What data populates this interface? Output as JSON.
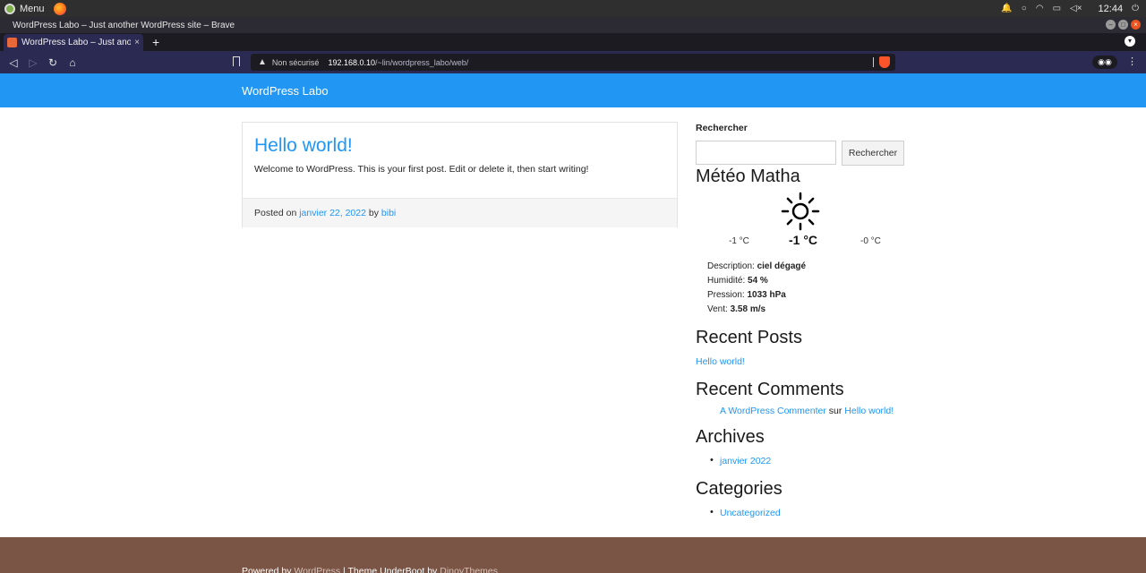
{
  "os": {
    "menu_label": "Menu",
    "clock": "12:44"
  },
  "window": {
    "title": "WordPress Labo – Just another WordPress site – Brave"
  },
  "tab": {
    "label": "WordPress Labo – Just another WordPress site",
    "close": "×",
    "new_tab": "+"
  },
  "address_bar": {
    "security_label": "Non sécurisé",
    "host": "192.168.0.10",
    "path": "/~lin/wordpress_labo/web/"
  },
  "site": {
    "title": "WordPress Labo",
    "accent_color": "#2196f3",
    "footer_color": "#7a5444"
  },
  "post": {
    "title": "Hello world!",
    "excerpt": "Welcome to WordPress. This is your first post. Edit or delete it, then start writing!",
    "posted_on": "Posted on",
    "date": "janvier 22, 2022",
    "by": "by",
    "author": "bibi"
  },
  "sidebar": {
    "search": {
      "label": "Rechercher",
      "button": "Rechercher",
      "value": ""
    },
    "weather": {
      "title": "Météo Matha",
      "icon": "sun-icon",
      "temp_min": "-1 °C",
      "temp_current": "-1 °C",
      "temp_max": "-0 °C",
      "description_label": "Description:",
      "description": "ciel dégagé",
      "humidity_label": "Humidité:",
      "humidity": "54 %",
      "pressure_label": "Pression:",
      "pressure": "1033 hPa",
      "wind_label": "Vent:",
      "wind": "3.58 m/s"
    },
    "recent_posts": {
      "title": "Recent Posts",
      "items": [
        "Hello world!"
      ]
    },
    "recent_comments": {
      "title": "Recent Comments",
      "commenter": "A WordPress Commenter",
      "on": "sur",
      "post": "Hello world!"
    },
    "archives": {
      "title": "Archives",
      "items": [
        "janvier 2022"
      ]
    },
    "categories": {
      "title": "Categories",
      "items": [
        "Uncategorized"
      ]
    }
  },
  "footer": {
    "powered_by": "Powered by",
    "wordpress": "WordPress",
    "theme_text": "| Theme UnderBoot by",
    "theme_author": "DinoyThemes"
  }
}
